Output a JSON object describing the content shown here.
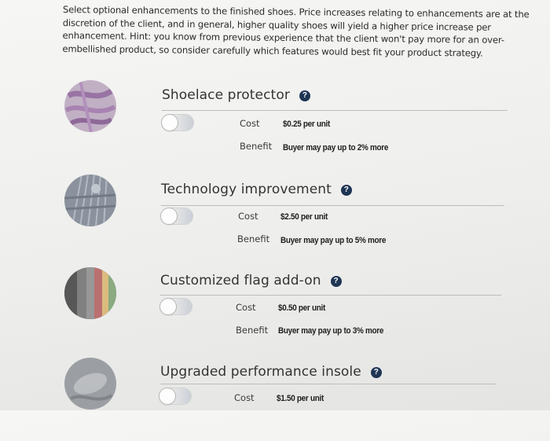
{
  "instructions": "Select optional enhancements to the finished shoes. Price increases relating to enhancements are at the discretion of the client, and in general, higher quality shoes will yield a higher price increase per enhancement. Hint: you know from previous experience that the client won't pay more for an over-embellished product, so consider carefully which features would best fit your product strategy.",
  "labels": {
    "cost": "Cost",
    "benefit": "Benefit",
    "help": "?"
  },
  "enhancements": [
    {
      "title": "Shoelace protector",
      "cost": "$0.25 per unit",
      "benefit": "Buyer may pay up to 2% more",
      "selected": false,
      "thumb_icon": "shoelace-photo"
    },
    {
      "title": "Technology improvement",
      "cost": "$2.50 per unit",
      "benefit": "Buyer may pay up to 5% more",
      "selected": false,
      "thumb_icon": "circuit-photo"
    },
    {
      "title": "Customized flag add-on",
      "cost": "$0.50 per unit",
      "benefit": "Buyer may pay up to 3% more",
      "selected": false,
      "thumb_icon": "flags-photo"
    },
    {
      "title": "Upgraded performance insole",
      "cost": "$1.50 per unit",
      "benefit": "",
      "selected": false,
      "thumb_icon": "insole-photo"
    }
  ],
  "colors": {
    "help_badge": "#1f3554",
    "rule": "#bdbdbd",
    "toggle_track": "#c9cfd6"
  }
}
